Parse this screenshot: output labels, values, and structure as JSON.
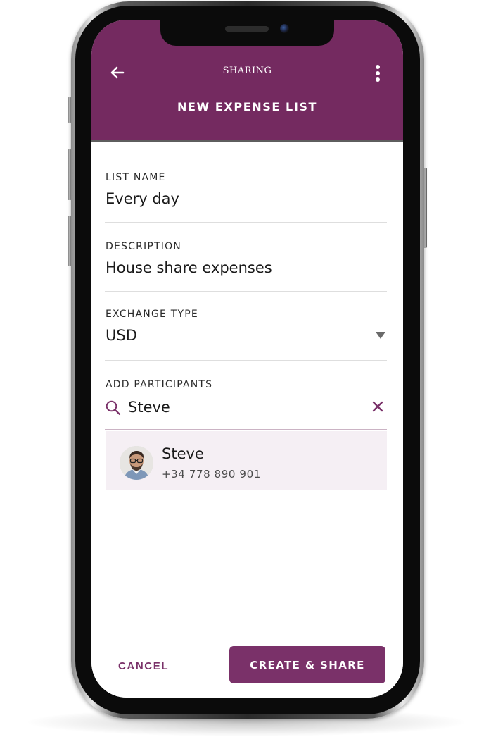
{
  "appbar": {
    "title": "SHARING",
    "subtitle": "NEW EXPENSE LIST",
    "back_icon": "arrow-left-icon",
    "menu_icon": "more-vertical-icon",
    "color": "#742a60"
  },
  "form": {
    "list_name": {
      "label": "LIST NAME",
      "value": "Every day"
    },
    "description": {
      "label": "DESCRIPTION",
      "value": "House share expenses"
    },
    "exchange_type": {
      "label": "EXCHANGE TYPE",
      "value": "USD",
      "icon": "caret-down-icon"
    },
    "participants": {
      "label": "ADD PARTICIPANTS",
      "search_value": "Steve",
      "search_icon": "search-icon",
      "clear_icon": "close-icon"
    }
  },
  "results": [
    {
      "name": "Steve",
      "phone": "+34 778 890 901",
      "avatar": "avatar-photo"
    }
  ],
  "actions": {
    "cancel_label": "CANCEL",
    "create_label": "CREATE & SHARE",
    "accent": "#7a3169"
  }
}
